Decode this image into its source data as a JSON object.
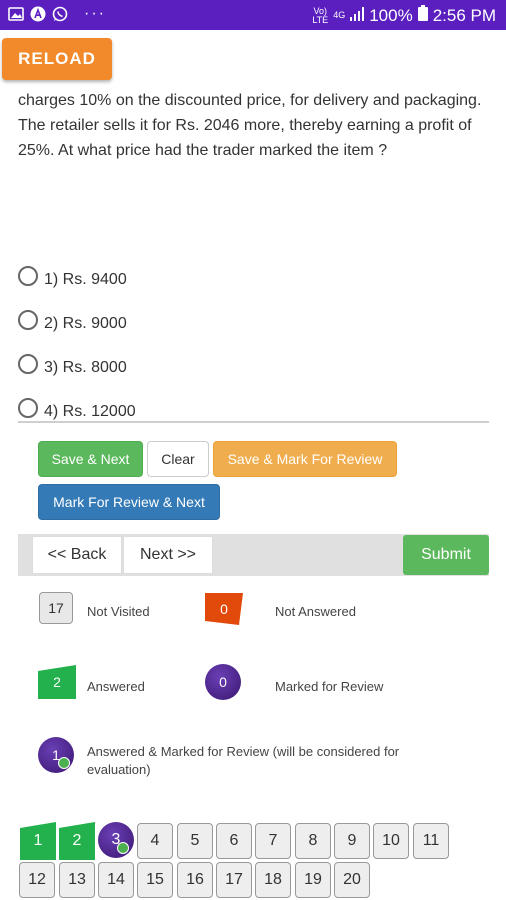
{
  "status_bar": {
    "battery": "100%",
    "time": "2:56 PM",
    "network_label_top": "Vo)",
    "network_label_bottom": "LTE",
    "signal_label": "4G",
    "left_icons": [
      "image-icon",
      "a-circle-icon",
      "whatsapp-icon"
    ],
    "more": "···"
  },
  "reload_label": "RELOAD",
  "question_text": "charges 10% on the discounted price, for delivery and packaging. The retailer sells it for Rs. 2046 more, thereby earning a profit of 25%. At what price had the trader marked the item ?",
  "options": [
    {
      "label": "1) Rs. 9400"
    },
    {
      "label": "2) Rs. 9000"
    },
    {
      "label": "3) Rs. 8000"
    },
    {
      "label": "4) Rs. 12000"
    }
  ],
  "actions": {
    "save_next": "Save & Next",
    "clear": "Clear",
    "save_mark_review": "Save & Mark For Review",
    "mark_review_next": "Mark For Review & Next"
  },
  "nav": {
    "back": "<< Back",
    "next": "Next >>",
    "submit": "Submit"
  },
  "legend": {
    "not_visited_count": "17",
    "not_visited_label": "Not Visited",
    "not_answered_count": "0",
    "not_answered_label": "Not Answered",
    "answered_count": "2",
    "answered_label": "Answered",
    "marked_count": "0",
    "marked_label": "Marked for Review",
    "answered_marked_count": "1",
    "answered_marked_label": "Answered & Marked for Review (will be considered for evaluation)"
  },
  "palette": {
    "row1": [
      "1",
      "2",
      "3",
      "4",
      "5",
      "6",
      "7",
      "8",
      "9",
      "10",
      "11"
    ],
    "row2": [
      "12",
      "13",
      "14",
      "15",
      "16",
      "17",
      "18",
      "19",
      "20"
    ],
    "states": {
      "1": "answered",
      "2": "answered",
      "3": "answered-marked"
    }
  },
  "colors": {
    "status_bar": "#5b1fc0",
    "reload": "#f2892b",
    "answered": "#22b14c",
    "not_answered": "#e24a0c",
    "marked": "#4b2390"
  }
}
